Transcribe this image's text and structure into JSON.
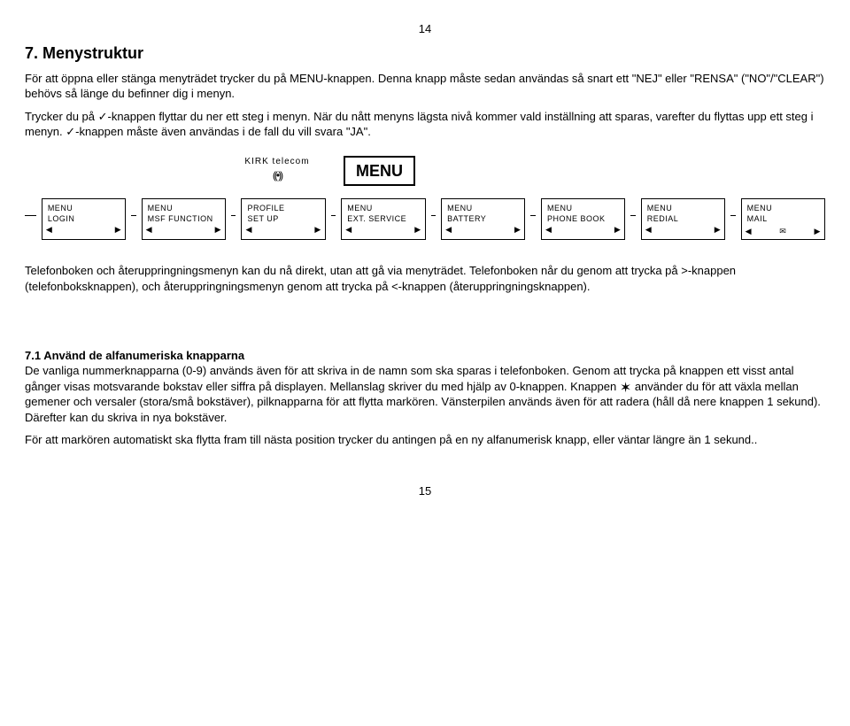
{
  "pageTop": "14",
  "pageBottom": "15",
  "title": "7. Menystruktur",
  "intro1": "För att öppna eller stänga menyträdet trycker du på MENU-knappen. Denna knapp måste sedan användas så snart ett \"NEJ\" eller \"RENSA\" (\"NO\"/\"CLEAR\") behövs så länge du befinner dig i menyn.",
  "intro2": "Trycker du på ✓-knappen flyttar du ner ett steg i menyn. När du nått menyns lägsta nivå kommer vald inställning att sparas, varefter du flyttas upp ett steg i menyn. ✓-knappen måste även användas i de fall du vill svara \"JA\".",
  "brand": "KIRK telecom",
  "signalGlyph": "((•))",
  "menuLabel": "MENU",
  "cards": [
    {
      "l1": "MENU",
      "l2": "LOGIN",
      "mail": false
    },
    {
      "l1": "MENU",
      "l2": "MSF FUNCTION",
      "mail": false
    },
    {
      "l1": "PROFILE",
      "l2": "SET UP",
      "mail": false
    },
    {
      "l1": "MENU",
      "l2": "EXT. SERVICE",
      "mail": false
    },
    {
      "l1": "MENU",
      "l2": "BATTERY",
      "mail": false
    },
    {
      "l1": "MENU",
      "l2": "PHONE BOOK",
      "mail": false
    },
    {
      "l1": "MENU",
      "l2": "REDIAL",
      "mail": false
    },
    {
      "l1": "MENU",
      "l2": "MAIL",
      "mail": true
    }
  ],
  "triLeft": "◀",
  "triRight": "▶",
  "mailGlyph": "✉",
  "para2": "Telefonboken och återuppringningsmenyn kan du nå direkt, utan att gå via menyträdet. Telefonboken når du genom att trycka på >-knappen (telefonboksknappen), och återuppringningsmenyn genom att trycka på <-knappen (återuppringningsknappen).",
  "sec71title": "7.1  Använd de alfanumeriska knapparna",
  "sec71a": "De vanliga nummerknapparna (0-9) används även för att skriva in de namn som ska sparas i telefonboken. Genom att trycka på knappen ett visst antal gånger visas motsvarande bokstav eller siffra på displayen. Mellanslag skriver du med hjälp av 0-knappen. Knappen ",
  "sec71b": " använder du för att växla mellan gemener och versaler (stora/små bokstäver), pilknapparna för att flytta markören. Vänsterpilen används även för att radera (håll då nere knappen 1 sekund). Därefter kan du skriva in nya bokstäver.",
  "sec71c": "För att markören automatiskt ska flytta fram till nästa position trycker du antingen på en ny alfanumerisk knapp, eller väntar längre än 1 sekund..",
  "starGlyph": "✶"
}
